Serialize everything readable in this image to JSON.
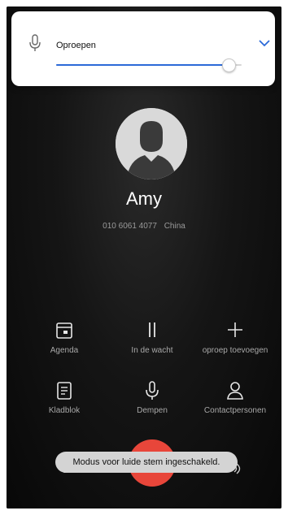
{
  "volume_panel": {
    "stream_label": "Oproepen",
    "level": 0.93,
    "mic_icon": "microphone-icon",
    "expand_icon": "chevron-down-icon",
    "accent_color": "#2b6ad8"
  },
  "caller": {
    "name": "Amy",
    "number": "010 6061 4077",
    "location": "China",
    "avatar_icon": "person-silhouette-icon"
  },
  "actions": [
    {
      "label": "Agenda",
      "icon": "calendar-icon"
    },
    {
      "label": "In de wacht",
      "icon": "pause-icon"
    },
    {
      "label": "oproep toevoegen",
      "icon": "plus-icon"
    },
    {
      "label": "Kladblok",
      "icon": "notepad-icon"
    },
    {
      "label": "Dempen",
      "icon": "microphone-icon"
    },
    {
      "label": "Contactpersonen",
      "icon": "contacts-icon"
    }
  ],
  "toast": {
    "message": "Modus voor luide stem ingeschakeld."
  },
  "end_call": {
    "icon": "end-call-icon",
    "color": "#e8463a"
  }
}
